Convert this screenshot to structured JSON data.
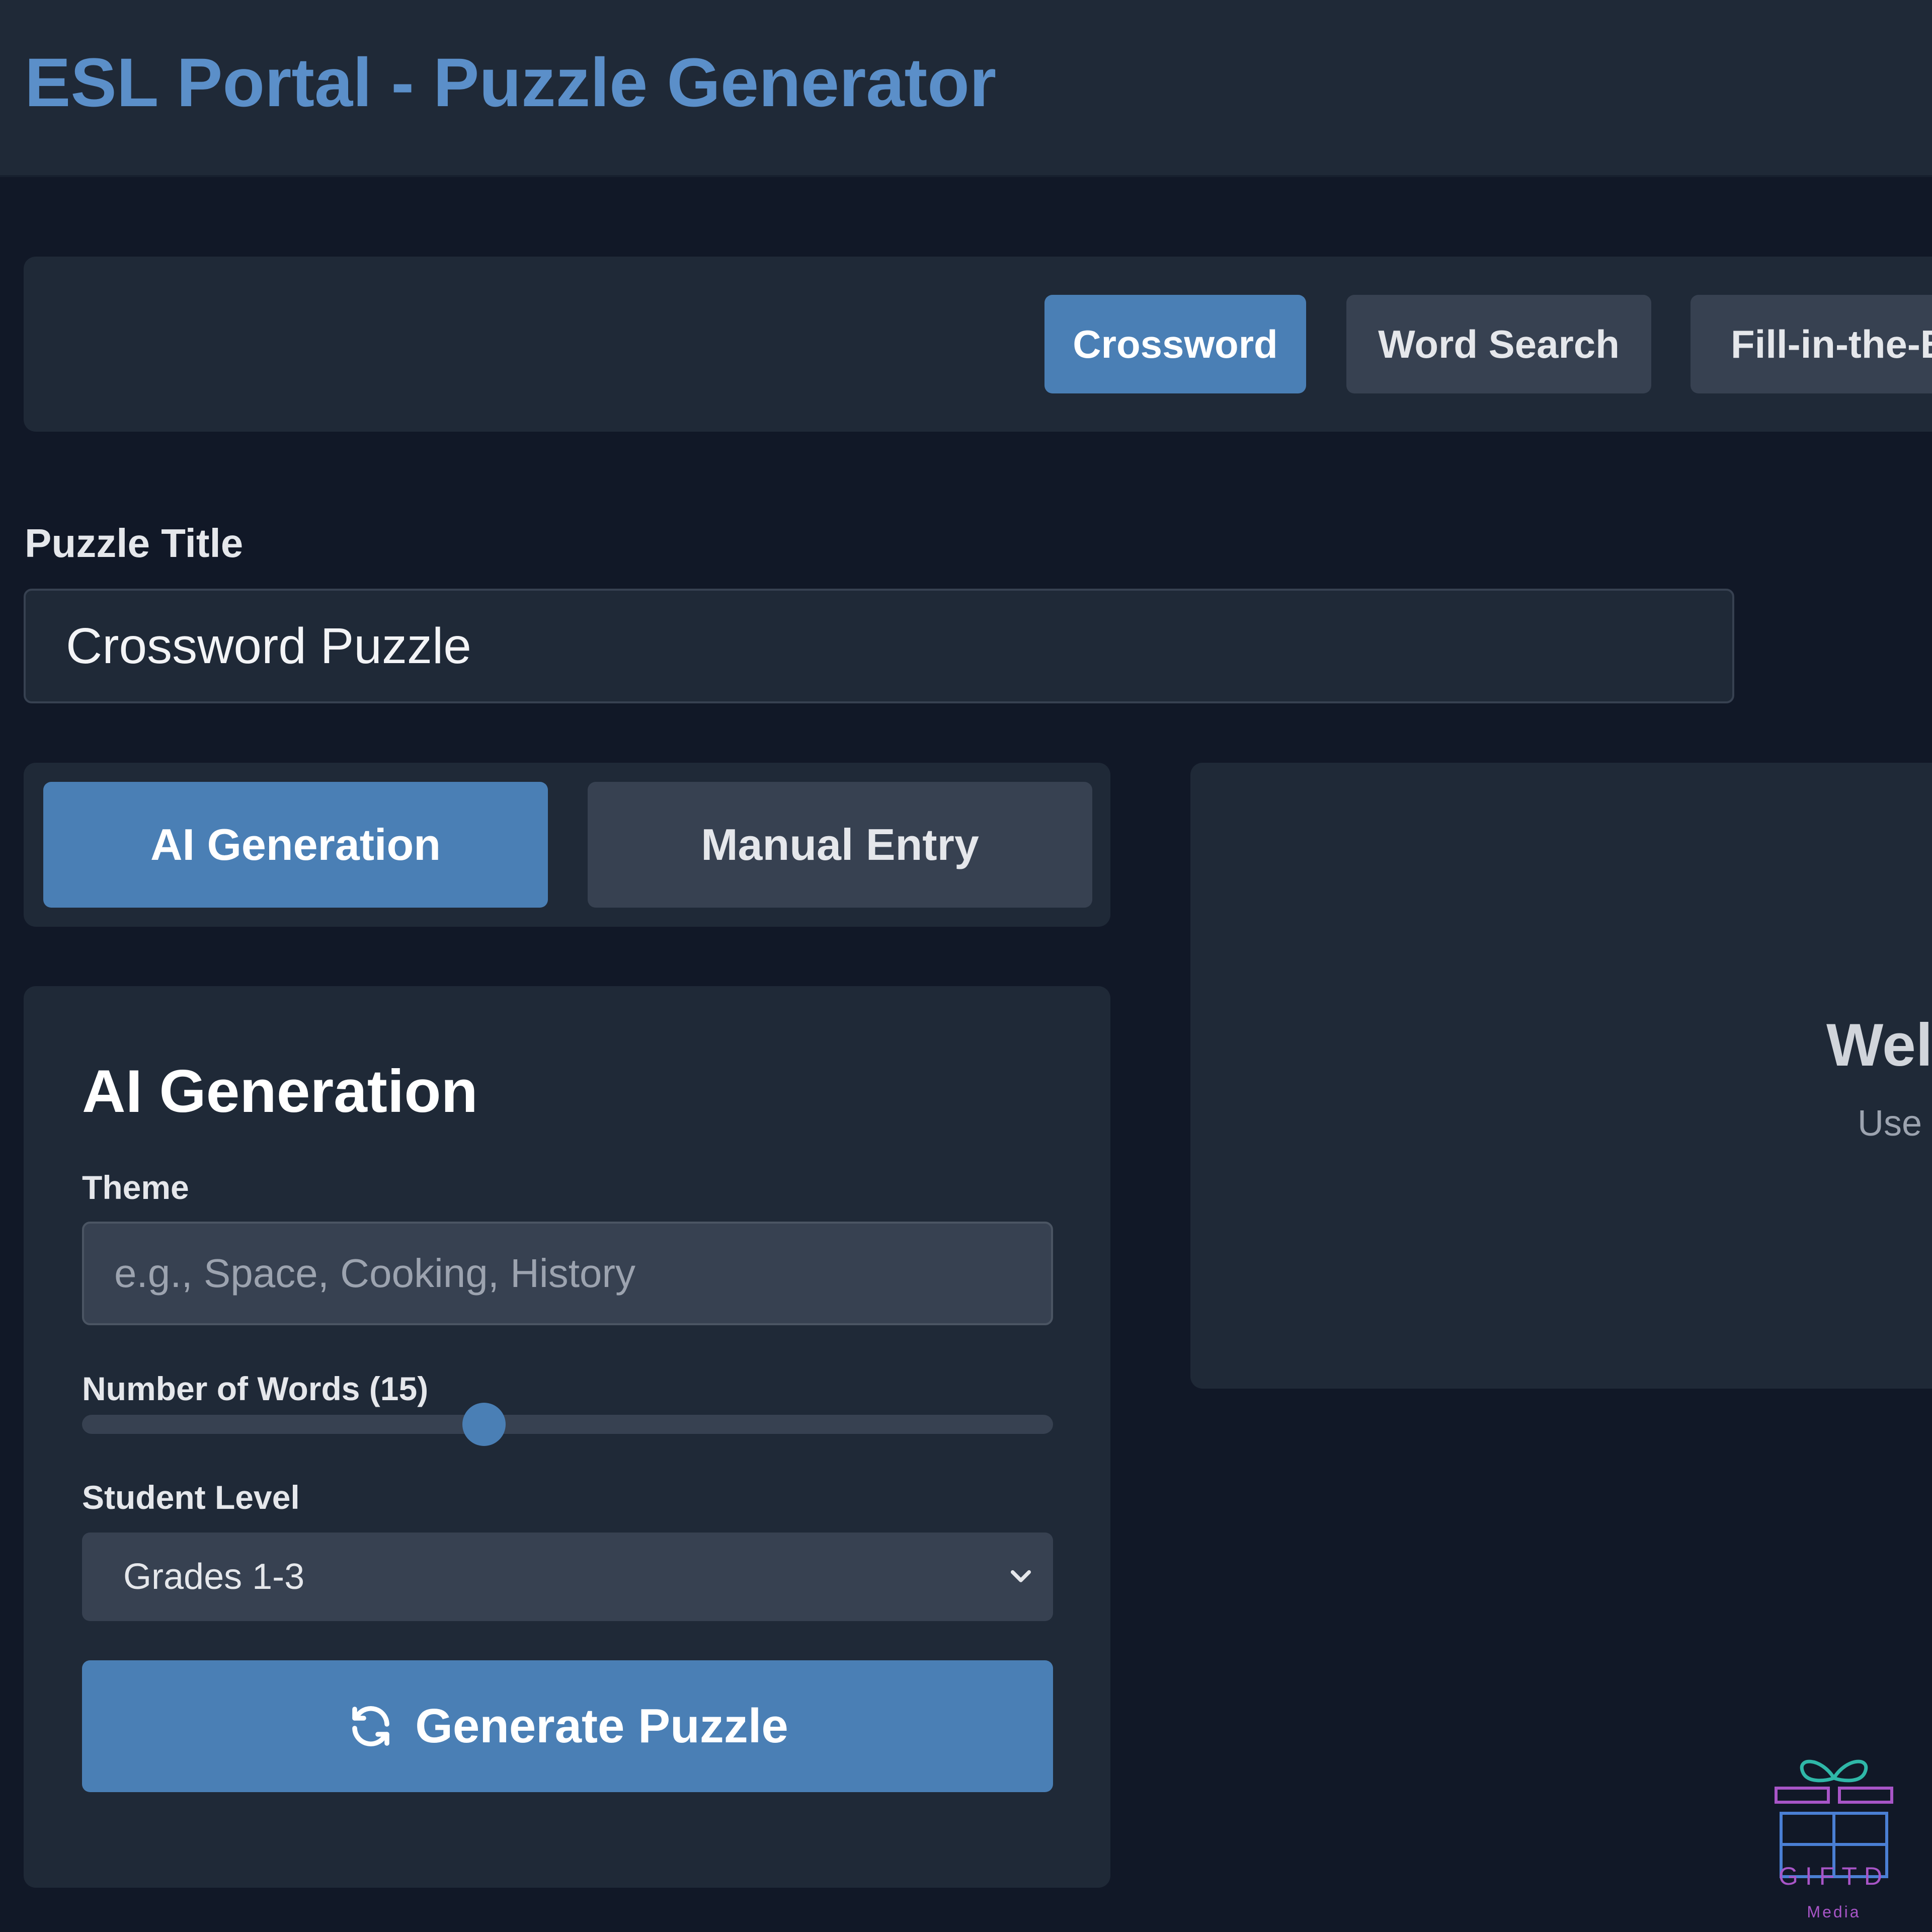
{
  "header": {
    "title": "ESL Portal - Puzzle Generator"
  },
  "puzzle_types": {
    "tabs": [
      {
        "label": "Crossword",
        "active": true
      },
      {
        "label": "Word Search",
        "active": false
      },
      {
        "label": "Fill-in-the-Blank",
        "active": false
      }
    ]
  },
  "puzzle_title": {
    "label": "Puzzle Title",
    "value": "Crossword Puzzle"
  },
  "mode_tabs": {
    "tabs": [
      {
        "label": "AI Generation",
        "active": true
      },
      {
        "label": "Manual Entry",
        "active": false
      }
    ]
  },
  "ai_panel": {
    "heading": "AI Generation",
    "theme": {
      "label": "Theme",
      "placeholder": "e.g., Space, Cooking, History",
      "value": ""
    },
    "word_count": {
      "label": "Number of Words (15)",
      "value": 15,
      "fraction": 0.41
    },
    "student_level": {
      "label": "Student Level",
      "selected": "Grades 1-3"
    },
    "generate_button": {
      "label": "Generate Puzzle",
      "icon": "refresh-icon"
    }
  },
  "preview": {
    "title": "Wel",
    "subtitle": "Use"
  },
  "logo": {
    "name": "GIFTD",
    "sub": "Media",
    "color": "#a855c7"
  },
  "colors": {
    "accent": "#4a7fb5",
    "title": "#5b8fc9",
    "background": "#111827",
    "panel": "#1f2937",
    "control": "#374151"
  }
}
